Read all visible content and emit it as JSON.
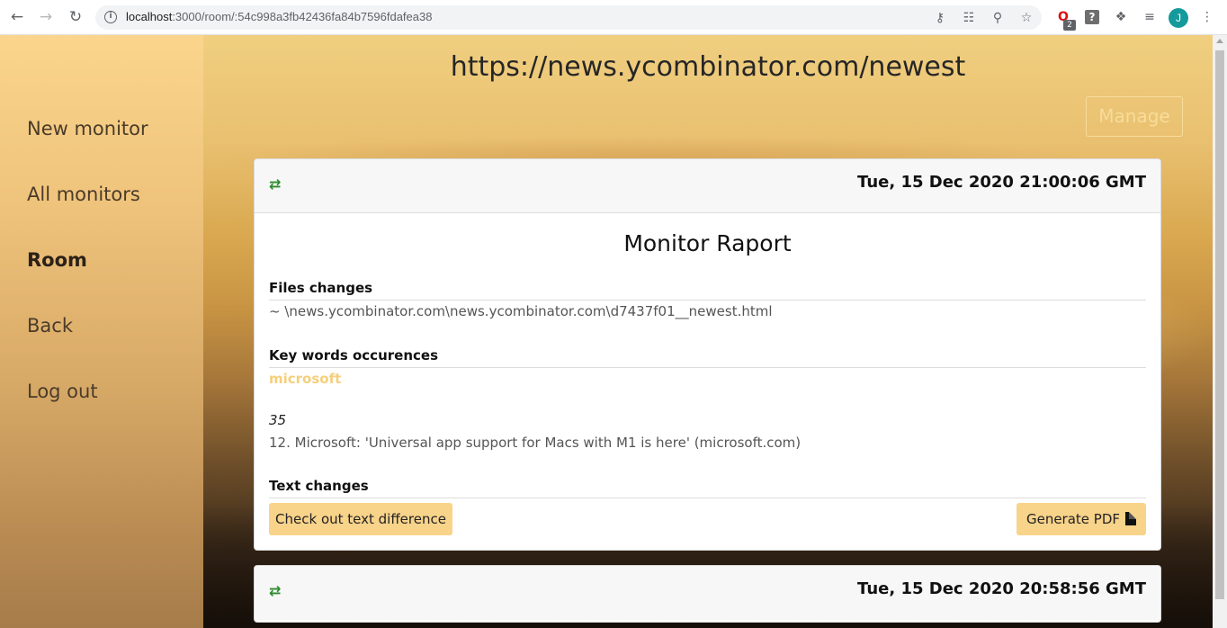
{
  "browser": {
    "url_host": "localhost",
    "url_rest": ":3000/room/:54c998a3fb42436fa84b7596fdafea38",
    "extension_badge": "2",
    "profile_initial": "J"
  },
  "sidebar": {
    "items": [
      {
        "label": "New monitor"
      },
      {
        "label": "All monitors"
      },
      {
        "label": "Room"
      },
      {
        "label": "Back"
      },
      {
        "label": "Log out"
      }
    ]
  },
  "header": {
    "title": "https://news.ycombinator.com/newest",
    "manage_label": "Manage"
  },
  "cards": [
    {
      "date": "Tue, 15 Dec 2020 21:00:06 GMT",
      "report_title": "Monitor Raport",
      "files_title": "Files changes",
      "files_value": "~ \\news.ycombinator.com\\news.ycombinator.com\\d7437f01__newest.html",
      "keywords_title": "Key words occurences",
      "keyword": "microsoft",
      "keyword_count": "35",
      "keyword_match": "12. Microsoft: 'Universal app support for Macs with M1 is here' (microsoft.com)",
      "text_changes_title": "Text changes",
      "diff_button": "Check out text difference",
      "pdf_button": "Generate PDF"
    },
    {
      "date": "Tue, 15 Dec 2020 20:58:56 GMT"
    }
  ],
  "colors": {
    "accent_yellow": "#f8d38a",
    "swap_green": "#2e8b2e",
    "profile_teal": "#159a9c"
  },
  "icons": {
    "card_header": "swap-arrows-icon",
    "pdf": "file-pdf-icon"
  }
}
